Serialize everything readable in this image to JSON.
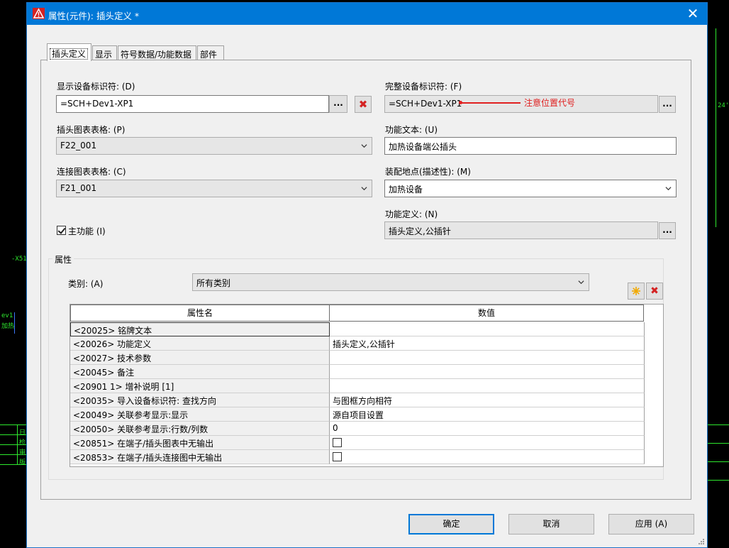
{
  "window": {
    "title": "属性(元件): 插头定义 *"
  },
  "tabs": [
    {
      "label": "插头定义",
      "active": true
    },
    {
      "label": "显示",
      "active": false
    },
    {
      "label": "符号数据/功能数据",
      "active": false
    },
    {
      "label": "部件",
      "active": false
    }
  ],
  "form": {
    "display_id_label": "显示设备标识符: (D)",
    "display_id_value": "=SCH+Dev1-XP1",
    "full_id_label": "完整设备标识符: (F)",
    "full_id_value": "=SCH+Dev1-XP1",
    "annotation": "注意位置代号",
    "plug_chart_label": "插头图表表格: (P)",
    "plug_chart_value": "F22_001",
    "func_text_label": "功能文本: (U)",
    "func_text_value": "加热设备端公插头",
    "conn_chart_label": "连接图表表格: (C)",
    "conn_chart_value": "F21_001",
    "mount_label": "装配地点(描述性): (M)",
    "mount_value": "加热设备",
    "main_func_label": "主功能 (I)",
    "main_func_checked": true,
    "func_def_label": "功能定义: (N)",
    "func_def_value": "插头定义,公插针",
    "ellipsis": "..."
  },
  "properties": {
    "group_title": "属性",
    "category_label": "类别: (A)",
    "category_value": "所有类别",
    "col_name": "属性名",
    "col_value": "数值",
    "rows": [
      {
        "name": "<20025> 铭牌文本",
        "value": "",
        "checkbox": false
      },
      {
        "name": "<20026> 功能定义",
        "value": "插头定义,公插针",
        "checkbox": false
      },
      {
        "name": "<20027> 技术参数",
        "value": "",
        "checkbox": false
      },
      {
        "name": "<20045> 备注",
        "value": "",
        "checkbox": false
      },
      {
        "name": "<20901 1> 增补说明 [1]",
        "value": "",
        "checkbox": false
      },
      {
        "name": "<20035> 导入设备标识符: 查找方向",
        "value": "与图框方向相符",
        "checkbox": false
      },
      {
        "name": "<20049> 关联参考显示:显示",
        "value": "源自项目设置",
        "checkbox": false
      },
      {
        "name": "<20050> 关联参考显示:行数/列数",
        "value": "0",
        "checkbox": false
      },
      {
        "name": "<20851> 在端子/插头图表中无输出",
        "value": "",
        "checkbox": true
      },
      {
        "name": "<20853> 在端子/插头连接图中无输出",
        "value": "",
        "checkbox": true
      }
    ]
  },
  "buttons": {
    "ok": "确定",
    "cancel": "取消",
    "apply": "应用 (A)"
  },
  "cad": {
    "label1": "-X51",
    "label2": "ev1",
    "label3": "加热",
    "label4": "24'",
    "side": [
      "日",
      "检",
      "审",
      "版"
    ]
  },
  "colors": {
    "titlebar": "#0078d7",
    "annotation": "#e02020",
    "cad_green": "#2ee82e"
  }
}
